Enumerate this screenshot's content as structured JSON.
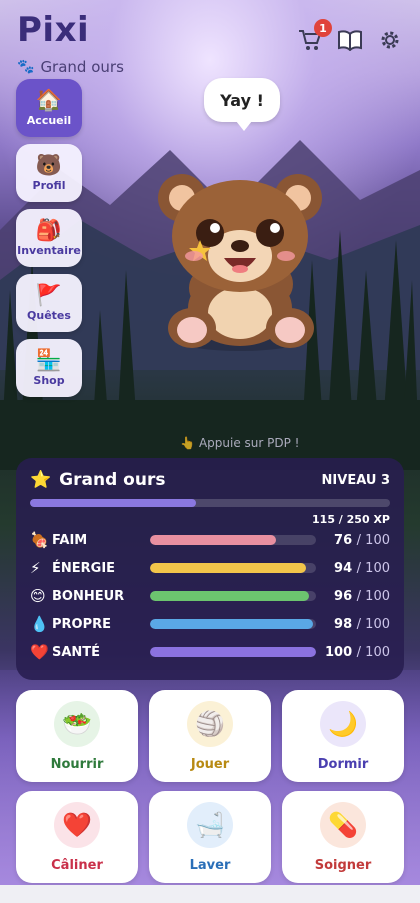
{
  "app": {
    "title": "Pixi",
    "subtitle": "Grand ours",
    "cart_badge": "1"
  },
  "icons": {
    "cart": "shopping-cart-icon",
    "book": "book-icon",
    "settings": "gear-icon"
  },
  "nav": [
    {
      "label": "Accueil",
      "icon": "🏠",
      "active": true
    },
    {
      "label": "Profil",
      "icon": "🐻",
      "active": false
    },
    {
      "label": "Inventaire",
      "icon": "🎒",
      "active": false
    },
    {
      "label": "Quêtes",
      "icon": "🚩",
      "active": false
    },
    {
      "label": "Shop",
      "icon": "🏪",
      "active": false
    }
  ],
  "pet": {
    "speech": "Yay !",
    "hint": "Appuie sur PDP !"
  },
  "stats": {
    "name": "Grand ours",
    "level": "NIVEAU 3",
    "xp_text": "115 / 250 XP",
    "xp_fraction": 0.46,
    "rows": [
      {
        "label": "FAIM",
        "icon": "🍖",
        "value": "76",
        "max": "/ 100",
        "color": "#e88fa0",
        "fraction": 0.76
      },
      {
        "label": "ÉNERGIE",
        "icon": "⚡",
        "value": "94",
        "max": "/ 100",
        "color": "#f2c54a",
        "fraction": 0.94
      },
      {
        "label": "BONHEUR",
        "icon": "😊",
        "value": "96",
        "max": "/ 100",
        "color": "#6cc46f",
        "fraction": 0.96
      },
      {
        "label": "PROPRE",
        "icon": "💧",
        "value": "98",
        "max": "/ 100",
        "color": "#5aa8e6",
        "fraction": 0.98
      },
      {
        "label": "SANTÉ",
        "icon": "❤️",
        "value": "100",
        "max": "/ 100",
        "color": "#8b72e0",
        "fraction": 1.0
      }
    ]
  },
  "actions": [
    {
      "label": "Nourrir",
      "icon": "🥗",
      "color": "#2f7a3c",
      "bg": "#e6f4e6"
    },
    {
      "label": "Jouer",
      "icon": "🏐",
      "color": "#b88a12",
      "bg": "#fbf1d6"
    },
    {
      "label": "Dormir",
      "icon": "🌙",
      "color": "#4a3fb0",
      "bg": "#ebe6fa"
    },
    {
      "label": "Câliner",
      "icon": "❤️",
      "color": "#c9304a",
      "bg": "#fbe3e8"
    },
    {
      "label": "Laver",
      "icon": "🛁",
      "color": "#2a6fb8",
      "bg": "#e2eefb"
    },
    {
      "label": "Soigner",
      "icon": "💊",
      "color": "#c23b3b",
      "bg": "#fbe6dc"
    }
  ]
}
